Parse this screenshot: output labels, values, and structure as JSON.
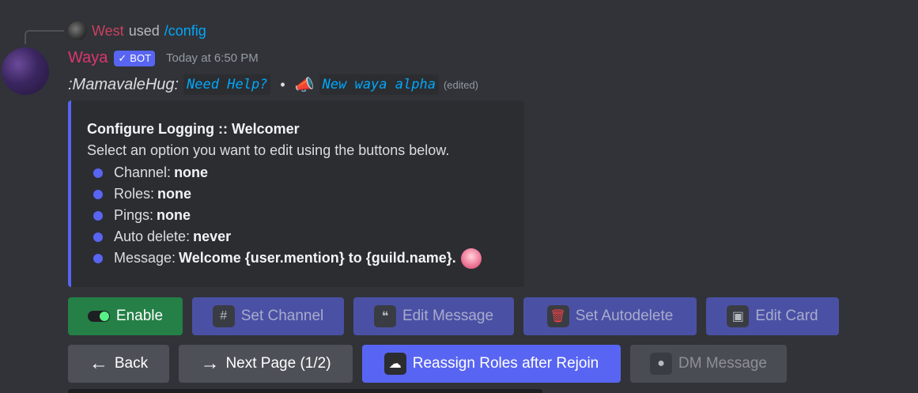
{
  "reply": {
    "name": "West",
    "used": "used",
    "command": "/config"
  },
  "message": {
    "username": "Waya",
    "bot_tag": "BOT",
    "timestamp": "Today at 6:50 PM",
    "emoji_text": ":MamavaleHug:",
    "link1": "Need Help?",
    "separator": "•",
    "link2": "New waya alpha",
    "edited": "(edited)"
  },
  "embed": {
    "title": "Configure Logging :: Welcomer",
    "description": "Select an option you want to edit using the buttons below.",
    "fields": [
      {
        "label": "Channel:",
        "value": "none"
      },
      {
        "label": "Roles:",
        "value": "none"
      },
      {
        "label": "Pings:",
        "value": "none"
      },
      {
        "label": "Auto delete:",
        "value": "never"
      },
      {
        "label": "Message:",
        "value": "Welcome {user.mention} to {guild.name}."
      }
    ],
    "accent_color": "#5865f2"
  },
  "buttons_row1": {
    "enable": "Enable",
    "set_channel": "Set Channel",
    "edit_message": "Edit Message",
    "set_autodelete": "Set Autodelete",
    "edit_card": "Edit Card"
  },
  "buttons_row2": {
    "back": "Back",
    "next_page": "Next Page (1/2)",
    "reassign_roles": "Reassign Roles after Rejoin",
    "dm_message": "DM Message"
  },
  "icons": {
    "hash": "#",
    "quote": "❝",
    "trash": "🗑",
    "image": "▣",
    "person": "●",
    "cloud": "☁",
    "arrow_left": "←",
    "arrow_right": "→",
    "check": "✓",
    "megaphone": "📣"
  }
}
